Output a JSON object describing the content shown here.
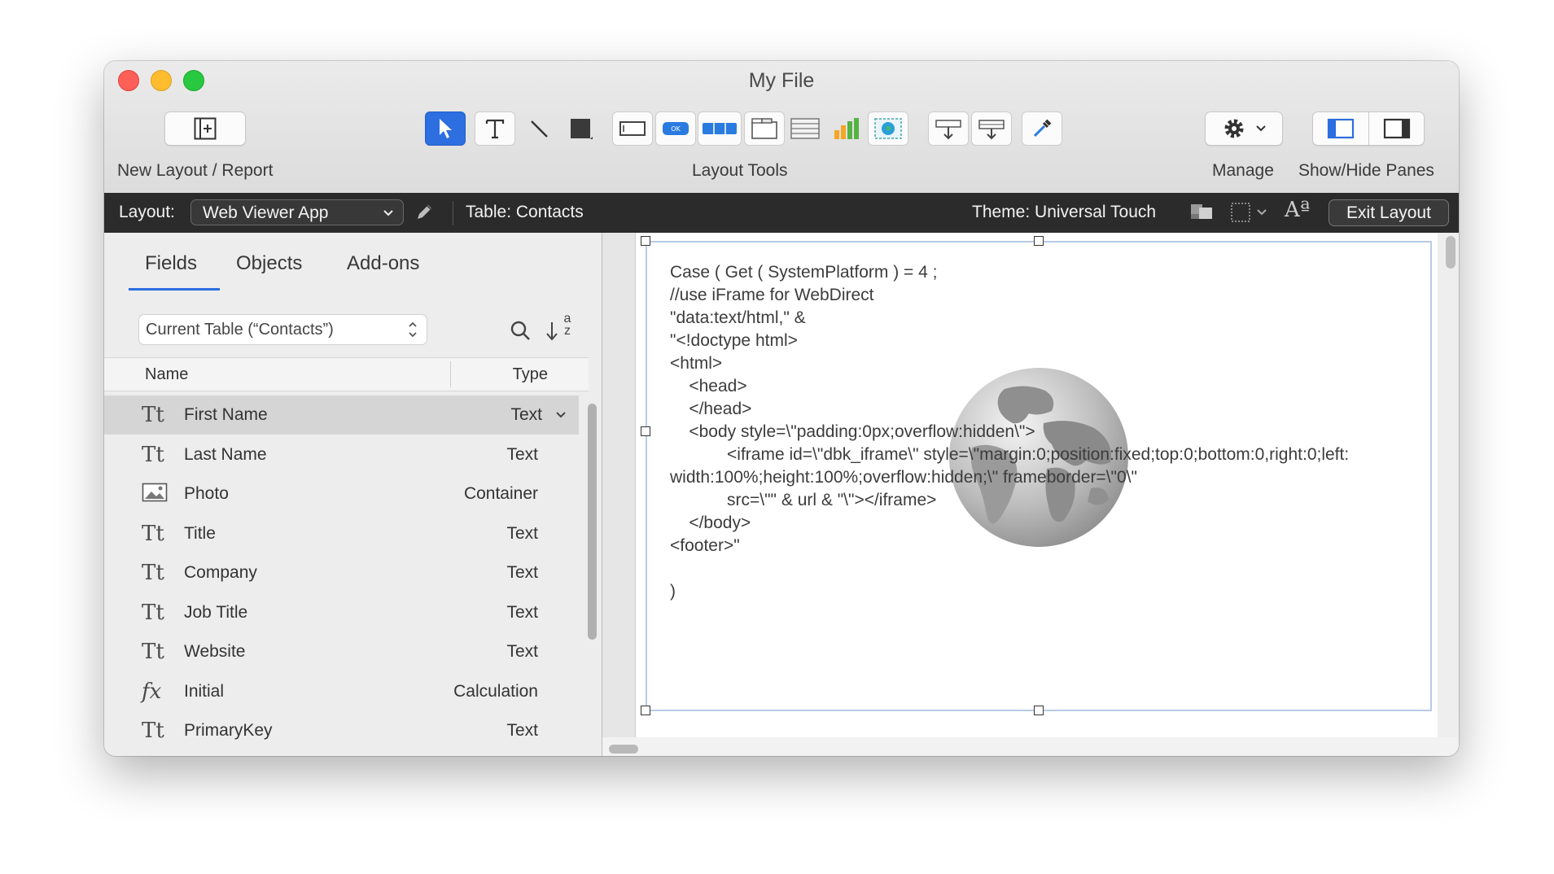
{
  "window": {
    "title": "My File"
  },
  "toolbar": {
    "new_layout_label": "New Layout / Report",
    "layout_tools_label": "Layout Tools",
    "manage_label": "Manage",
    "show_hide_label": "Show/Hide Panes",
    "tools": [
      {
        "name": "selection-tool",
        "icon": "arrow-pointer-icon"
      },
      {
        "name": "text-tool",
        "icon": "text-t-icon"
      },
      {
        "name": "line-tool",
        "icon": "line-icon"
      },
      {
        "name": "shape-tool",
        "icon": "rectangle-icon"
      },
      {
        "name": "field-tool",
        "icon": "field-icon"
      },
      {
        "name": "button-tool",
        "icon": "button-icon"
      },
      {
        "name": "button-bar-tool",
        "icon": "button-bar-icon"
      },
      {
        "name": "tab-control-tool",
        "icon": "tab-control-icon"
      },
      {
        "name": "portal-tool",
        "icon": "portal-icon"
      },
      {
        "name": "chart-tool",
        "icon": "bar-chart-icon"
      },
      {
        "name": "web-viewer-tool",
        "icon": "web-viewer-icon"
      },
      {
        "name": "insert-field-tool",
        "icon": "insert-field-icon"
      },
      {
        "name": "insert-part-tool",
        "icon": "insert-part-icon"
      },
      {
        "name": "format-painter-tool",
        "icon": "eyedropper-icon"
      }
    ]
  },
  "layout_bar": {
    "layout_label": "Layout:",
    "layout_value": "Web Viewer App",
    "table_label": "Table: Contacts",
    "theme_label": "Theme: Universal Touch",
    "exit_label": "Exit Layout",
    "font_glyph": "Aª"
  },
  "left_pane": {
    "tabs": [
      "Fields",
      "Objects",
      "Add-ons"
    ],
    "active_tab": "Fields",
    "table_select": "Current Table (“Contacts”)",
    "sort_glyph": "a z",
    "columns": {
      "name": "Name",
      "type": "Type"
    },
    "fields": [
      {
        "name": "First Name",
        "type": "Text",
        "icon": "text-field-icon",
        "selected": true
      },
      {
        "name": "Last Name",
        "type": "Text",
        "icon": "text-field-icon"
      },
      {
        "name": "Photo",
        "type": "Container",
        "icon": "photo-icon"
      },
      {
        "name": "Title",
        "type": "Text",
        "icon": "text-field-icon"
      },
      {
        "name": "Company",
        "type": "Text",
        "icon": "text-field-icon"
      },
      {
        "name": "Job Title",
        "type": "Text",
        "icon": "text-field-icon"
      },
      {
        "name": "Website",
        "type": "Text",
        "icon": "text-field-icon"
      },
      {
        "name": "Initial",
        "type": "Calculation",
        "icon": "calculation-icon"
      },
      {
        "name": "PrimaryKey",
        "type": "Text",
        "icon": "text-field-icon"
      }
    ]
  },
  "canvas": {
    "code_lines": [
      "Case ( Get ( SystemPlatform ) = 4 ;",
      "//use iFrame for WebDirect",
      "\"data:text/html,\" &",
      "\"<!doctype html>",
      "<html>",
      "    <head>",
      "    </head>",
      "    <body style=\\\"padding:0px;overflow:hidden\\\">",
      "            <iframe id=\\\"dbk_iframe\\\" style=\\\"margin:0;position:fixed;top:0;bottom:0,right:0;left:",
      "width:100%;height:100%;overflow:hidden;\\\" frameborder=\\\"0\\\"",
      "            src=\\\"\" & url & \"\\\"></iframe>",
      "    </body>",
      "<footer>\"",
      "",
      ")"
    ]
  },
  "colors": {
    "accent": "#2d6ee0",
    "layout_bar": "#2b2b2b",
    "selection_row": "#d5d5d5",
    "web_viewer_border": "#b7cbe8"
  }
}
